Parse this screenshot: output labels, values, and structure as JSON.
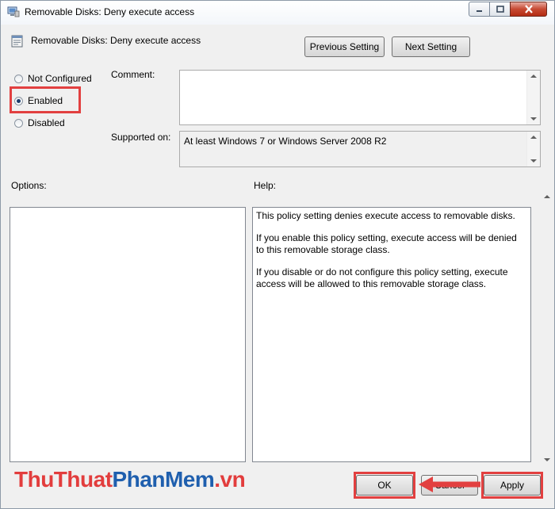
{
  "window": {
    "title": "Removable Disks: Deny execute access"
  },
  "header": {
    "policy_name": "Removable Disks: Deny execute access",
    "prev_label": "Previous Setting",
    "next_label": "Next Setting"
  },
  "state": {
    "options": [
      {
        "label": "Not Configured",
        "checked": false
      },
      {
        "label": "Enabled",
        "checked": true
      },
      {
        "label": "Disabled",
        "checked": false
      }
    ]
  },
  "comment": {
    "label": "Comment:",
    "value": ""
  },
  "supported": {
    "label": "Supported on:",
    "value": "At least Windows 7 or Windows Server 2008 R2"
  },
  "options_section": {
    "label": "Options:"
  },
  "help": {
    "label": "Help:",
    "paragraphs": [
      "This policy setting denies execute access to removable disks.",
      "If you enable this policy setting, execute access will be denied to this removable storage class.",
      "If you disable or do not configure this policy setting, execute access will be allowed to this removable storage class."
    ]
  },
  "footer": {
    "ok_label": "OK",
    "cancel_label": "Cancel",
    "apply_label": "Apply"
  },
  "watermark": {
    "part1": "ThuThuat",
    "part2": "PhanMem",
    "part3": ".vn"
  },
  "colors": {
    "highlight": "#e24040",
    "watermark_red": "#e23d3d",
    "watermark_blue": "#1f5fae"
  }
}
